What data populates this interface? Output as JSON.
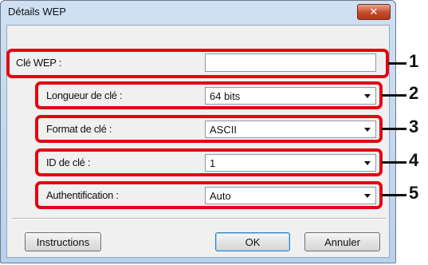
{
  "window": {
    "title": "Détails WEP",
    "close_glyph": "✕"
  },
  "fields": {
    "wep_key": {
      "label": "Clé WEP :",
      "value": ""
    },
    "key_length": {
      "label": "Longueur de clé :",
      "value": "64 bits"
    },
    "key_format": {
      "label": "Format de clé :",
      "value": "ASCII"
    },
    "key_id": {
      "label": "ID de clé :",
      "value": "1"
    },
    "authentication": {
      "label": "Authentification :",
      "value": "Auto"
    }
  },
  "buttons": {
    "instructions": "Instructions",
    "ok": "OK",
    "cancel": "Annuler"
  },
  "callout_numbers": [
    "1",
    "2",
    "3",
    "4",
    "5"
  ],
  "colors": {
    "callout": "#e30613",
    "titlebar": "#b9d1ec",
    "close_button": "#c44a2a"
  }
}
